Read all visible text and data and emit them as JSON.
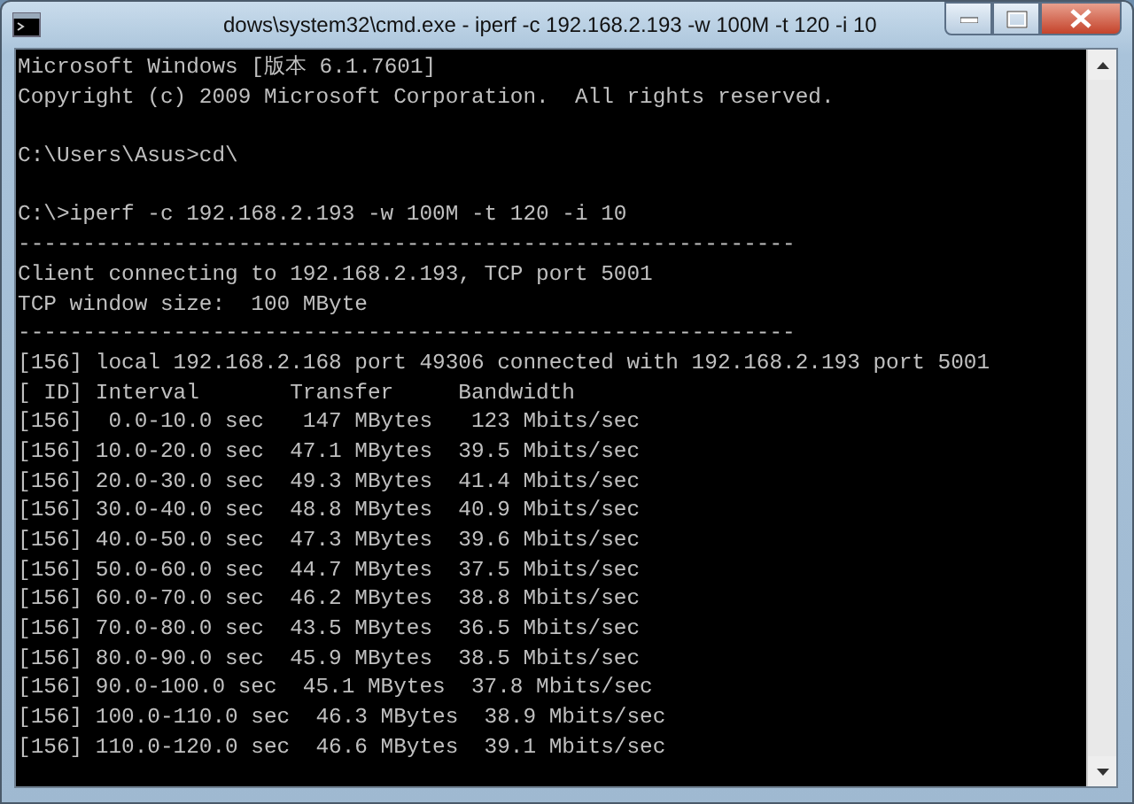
{
  "window": {
    "title": "dows\\system32\\cmd.exe - iperf  -c 192.168.2.193 -w 100M -t 120 -i 10"
  },
  "console": {
    "blocks": [
      [
        "Microsoft Windows [版本 6.1.7601]",
        "Copyright (c) 2009 Microsoft Corporation.  All rights reserved."
      ],
      [
        "C:\\Users\\Asus>cd\\"
      ],
      [
        "C:\\>iperf -c 192.168.2.193 -w 100M -t 120 -i 10",
        "------------------------------------------------------------",
        "Client connecting to 192.168.2.193, TCP port 5001",
        "TCP window size:  100 MByte",
        "------------------------------------------------------------",
        "[156] local 192.168.2.168 port 49306 connected with 192.168.2.193 port 5001",
        "[ ID] Interval       Transfer     Bandwidth",
        "[156]  0.0-10.0 sec   147 MBytes   123 Mbits/sec",
        "[156] 10.0-20.0 sec  47.1 MBytes  39.5 Mbits/sec",
        "[156] 20.0-30.0 sec  49.3 MBytes  41.4 Mbits/sec",
        "[156] 30.0-40.0 sec  48.8 MBytes  40.9 Mbits/sec",
        "[156] 40.0-50.0 sec  47.3 MBytes  39.6 Mbits/sec",
        "[156] 50.0-60.0 sec  44.7 MBytes  37.5 Mbits/sec",
        "[156] 60.0-70.0 sec  46.2 MBytes  38.8 Mbits/sec",
        "[156] 70.0-80.0 sec  43.5 MBytes  36.5 Mbits/sec",
        "[156] 80.0-90.0 sec  45.9 MBytes  38.5 Mbits/sec",
        "[156] 90.0-100.0 sec  45.1 MBytes  37.8 Mbits/sec",
        "[156] 100.0-110.0 sec  46.3 MBytes  38.9 Mbits/sec",
        "[156] 110.0-120.0 sec  46.6 MBytes  39.1 Mbits/sec"
      ]
    ]
  }
}
